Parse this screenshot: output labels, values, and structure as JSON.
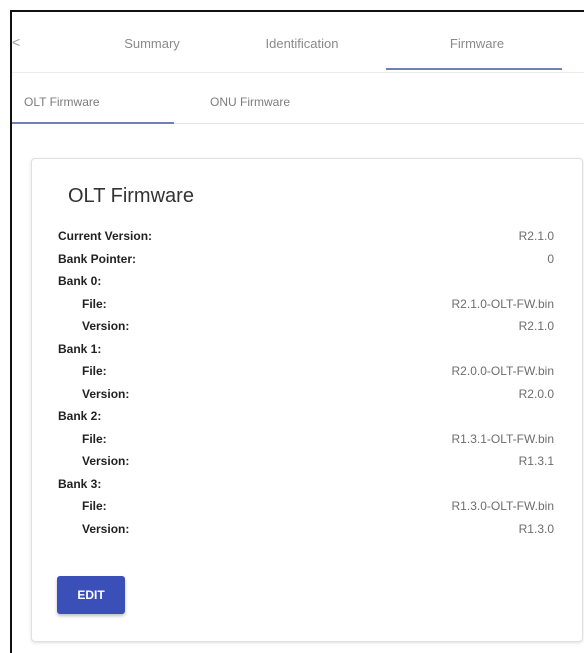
{
  "tabs": {
    "scroll_left": "<",
    "items": [
      "Summary",
      "Identification",
      "Firmware"
    ],
    "active": "Firmware"
  },
  "subtabs": {
    "items": [
      "OLT Firmware",
      "ONU Firmware"
    ],
    "active": "OLT Firmware"
  },
  "card": {
    "title": "OLT Firmware",
    "rows": [
      {
        "label": "Current Version:",
        "value": "R2.1.0",
        "indent": false
      },
      {
        "label": "Bank Pointer:",
        "value": "0",
        "indent": false
      },
      {
        "label": "Bank 0:",
        "value": "",
        "indent": false
      },
      {
        "label": "File:",
        "value": "R2.1.0-OLT-FW.bin",
        "indent": true
      },
      {
        "label": "Version:",
        "value": "R2.1.0",
        "indent": true
      },
      {
        "label": "Bank 1:",
        "value": "",
        "indent": false
      },
      {
        "label": "File:",
        "value": "R2.0.0-OLT-FW.bin",
        "indent": true
      },
      {
        "label": "Version:",
        "value": "R2.0.0",
        "indent": true
      },
      {
        "label": "Bank 2:",
        "value": "",
        "indent": false
      },
      {
        "label": "File:",
        "value": "R1.3.1-OLT-FW.bin",
        "indent": true
      },
      {
        "label": "Version:",
        "value": "R1.3.1",
        "indent": true
      },
      {
        "label": "Bank 3:",
        "value": "",
        "indent": false
      },
      {
        "label": "File:",
        "value": "R1.3.0-OLT-FW.bin",
        "indent": true
      },
      {
        "label": "Version:",
        "value": "R1.3.0",
        "indent": true
      }
    ],
    "edit_label": "EDIT"
  },
  "colors": {
    "accent": "#3b4fb8",
    "tab_indicator": "#6f7fb8"
  }
}
